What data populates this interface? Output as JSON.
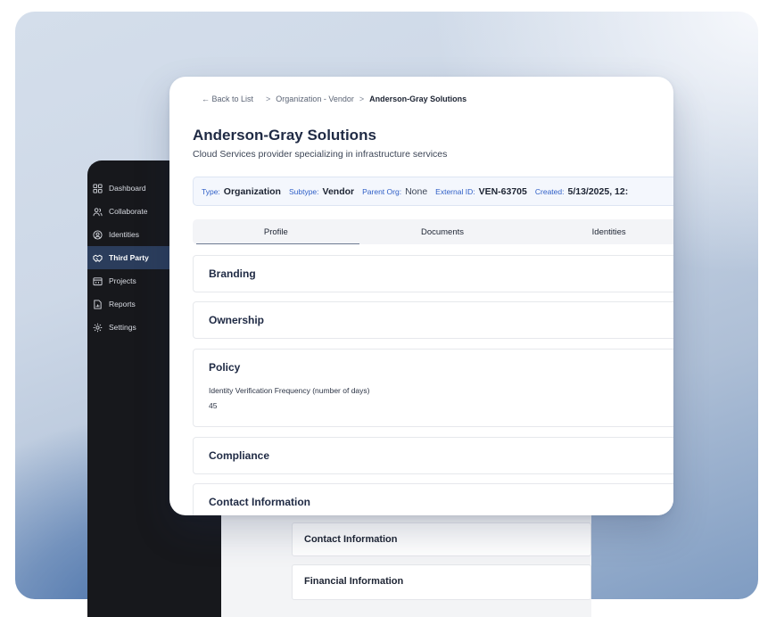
{
  "sidebar": {
    "items": [
      {
        "label": "Dashboard",
        "icon": "dashboard-icon"
      },
      {
        "label": "Collaborate",
        "icon": "people-icon"
      },
      {
        "label": "Identities",
        "icon": "identity-icon"
      },
      {
        "label": "Third Party",
        "icon": "handshake-icon",
        "active": true
      },
      {
        "label": "Projects",
        "icon": "projects-icon"
      },
      {
        "label": "Reports",
        "icon": "report-icon"
      },
      {
        "label": "Settings",
        "icon": "gear-icon"
      }
    ]
  },
  "breadcrumb": {
    "back": "← Back to List",
    "sep": ">",
    "parent": "Organization - Vendor",
    "current": "Anderson-Gray Solutions"
  },
  "header": {
    "title": "Anderson-Gray Solutions",
    "subtitle": "Cloud Services provider specializing in infrastructure services"
  },
  "meta": {
    "type_label": "Type:",
    "type_value": "Organization",
    "subtype_label": "Subtype:",
    "subtype_value": "Vendor",
    "parent_label": "Parent Org:",
    "parent_value": "None",
    "external_label": "External ID:",
    "external_value": "VEN-63705",
    "created_label": "Created:",
    "created_value": "5/13/2025, 12:"
  },
  "tabs": [
    "Profile",
    "Documents",
    "Identities"
  ],
  "sections": {
    "branding": "Branding",
    "ownership": "Ownership",
    "policy": "Policy",
    "policy_field_label": "Identity Verification Frequency (number of days)",
    "policy_field_value": "45",
    "compliance": "Compliance",
    "contact": "Contact Information"
  },
  "back_cards": [
    "Contact Information",
    "Financial Information"
  ],
  "colors": {
    "accent": "#2f5fc7",
    "sidebar_bg": "#17181c",
    "sidebar_active": "#2b3d5c"
  }
}
